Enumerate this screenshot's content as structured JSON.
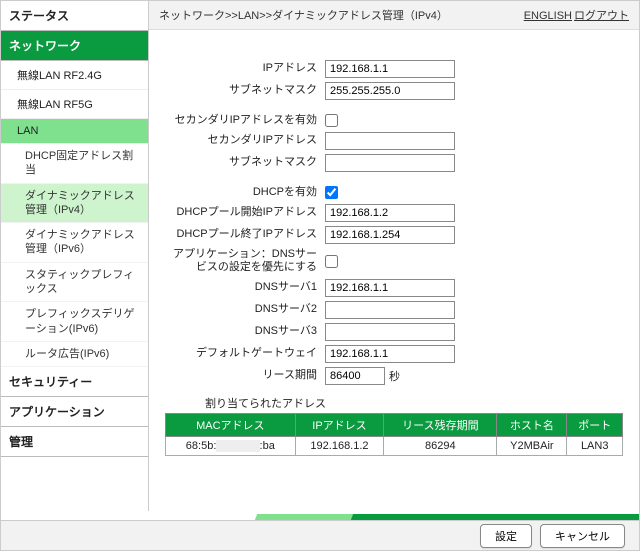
{
  "sidebar": {
    "groups": [
      {
        "label": "ステータス"
      },
      {
        "label": "ネットワーク",
        "active": true
      },
      {
        "label": "セキュリティー"
      },
      {
        "label": "アプリケーション"
      },
      {
        "label": "管理"
      }
    ],
    "network_items": [
      {
        "label": "無線LAN RF2.4G"
      },
      {
        "label": "無線LAN RF5G"
      },
      {
        "label": "LAN",
        "selected": true
      }
    ],
    "lan_subs": [
      {
        "label": "DHCP固定アドレス割当"
      },
      {
        "label": "ダイナミックアドレス管理（IPv4）",
        "selected": true
      },
      {
        "label": "ダイナミックアドレス管理（IPv6）"
      },
      {
        "label": "スタティックプレフィックス"
      },
      {
        "label": "プレフィックスデリゲーション(IPv6)"
      },
      {
        "label": "ルータ広告(IPv6)"
      }
    ]
  },
  "header": {
    "breadcrumb": "ネットワーク>>LAN>>ダイナミックアドレス管理（IPv4）",
    "english": "ENGLISH",
    "logout": "ログアウト"
  },
  "form": {
    "ip_label": "IPアドレス",
    "ip": "192.168.1.1",
    "subnet_label": "サブネットマスク",
    "subnet": "255.255.255.0",
    "sec_enable_label": "セカンダリIPアドレスを有効",
    "sec_enable": false,
    "sec_ip_label": "セカンダリIPアドレス",
    "sec_ip": "",
    "sec_subnet_label": "サブネットマスク",
    "sec_subnet": "",
    "dhcp_enable_label": "DHCPを有効",
    "dhcp_enable": true,
    "pool_start_label": "DHCPプール開始IPアドレス",
    "pool_start": "192.168.1.2",
    "pool_end_label": "DHCPプール終了IPアドレス",
    "pool_end": "192.168.1.254",
    "app_dns_label": "アプリケーション：DNSサービスの設定を優先にする",
    "app_dns": false,
    "dns1_label": "DNSサーバ1",
    "dns1": "192.168.1.1",
    "dns2_label": "DNSサーバ2",
    "dns2": "",
    "dns3_label": "DNSサーバ3",
    "dns3": "",
    "gw_label": "デフォルトゲートウェイ",
    "gw": "192.168.1.1",
    "lease_label": "リース期間",
    "lease": "86400",
    "lease_unit": "秒"
  },
  "assigned": {
    "title": "割り当てられたアドレス",
    "headers": [
      "MACアドレス",
      "IPアドレス",
      "リース残存期間",
      "ホスト名",
      "ポート"
    ],
    "rows": [
      {
        "mac_prefix": "68:5b:",
        "mac_suffix": ":ba",
        "ip": "192.168.1.2",
        "lease": "86294",
        "host": "Y2MBAir",
        "port": "LAN3"
      }
    ]
  },
  "footer": {
    "apply": "設定",
    "cancel": "キャンセル"
  }
}
